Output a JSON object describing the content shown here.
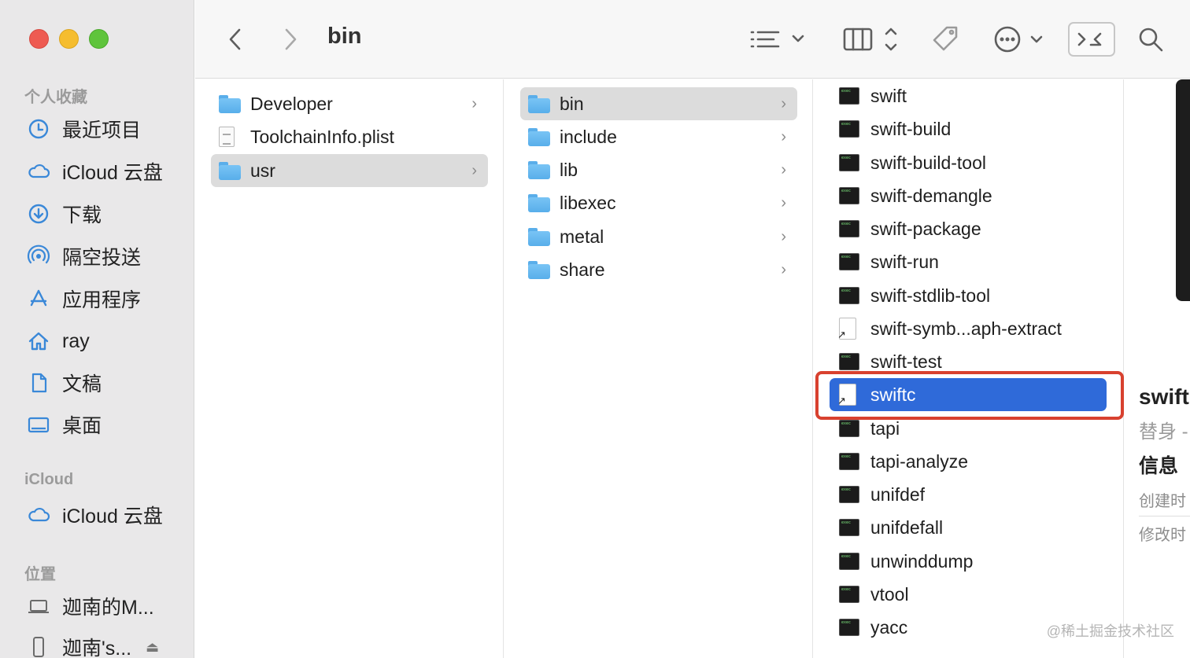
{
  "window": {
    "title": "bin"
  },
  "toolbar": {
    "back_icon": "chevron-left-icon",
    "forward_icon": "chevron-right-icon",
    "view_icon": "list-view-icon",
    "group_icon": "columns-icon",
    "tag_icon": "tag-icon",
    "more_icon": "ellipsis-circle-icon",
    "terminal_icon": "terminal-icon",
    "search_icon": "search-icon"
  },
  "sidebar": {
    "favorites_header": "个人收藏",
    "favorites": [
      {
        "label": "最近项目",
        "icon": "clock-icon"
      },
      {
        "label": "iCloud 云盘",
        "icon": "cloud-icon"
      },
      {
        "label": "下载",
        "icon": "download-icon"
      },
      {
        "label": "隔空投送",
        "icon": "airdrop-icon"
      },
      {
        "label": "应用程序",
        "icon": "apps-icon"
      },
      {
        "label": "ray",
        "icon": "home-icon"
      },
      {
        "label": "文稿",
        "icon": "document-icon"
      },
      {
        "label": "桌面",
        "icon": "desktop-icon"
      }
    ],
    "icloud_header": "iCloud",
    "icloud": [
      {
        "label": "iCloud 云盘",
        "icon": "cloud-icon"
      }
    ],
    "locations_header": "位置",
    "locations": [
      {
        "label": "迦南的M...",
        "icon": "laptop-icon"
      },
      {
        "label": "迦南's...",
        "icon": "phone-icon"
      }
    ]
  },
  "columns": [
    {
      "items": [
        {
          "name": "Developer",
          "type": "folder",
          "chevron": true
        },
        {
          "name": "ToolchainInfo.plist",
          "type": "plist",
          "chevron": false
        },
        {
          "name": "usr",
          "type": "folder",
          "chevron": true,
          "selected": "grey"
        }
      ]
    },
    {
      "items": [
        {
          "name": "bin",
          "type": "folder",
          "chevron": true,
          "selected": "grey"
        },
        {
          "name": "include",
          "type": "folder",
          "chevron": true
        },
        {
          "name": "lib",
          "type": "folder",
          "chevron": true
        },
        {
          "name": "libexec",
          "type": "folder",
          "chevron": true
        },
        {
          "name": "metal",
          "type": "folder",
          "chevron": true
        },
        {
          "name": "share",
          "type": "folder",
          "chevron": true
        }
      ]
    },
    {
      "items": [
        {
          "name": "swift",
          "type": "exec"
        },
        {
          "name": "swift-build",
          "type": "exec"
        },
        {
          "name": "swift-build-tool",
          "type": "exec"
        },
        {
          "name": "swift-demangle",
          "type": "exec"
        },
        {
          "name": "swift-package",
          "type": "exec"
        },
        {
          "name": "swift-run",
          "type": "exec"
        },
        {
          "name": "swift-stdlib-tool",
          "type": "exec"
        },
        {
          "name": "swift-symb...aph-extract",
          "type": "alias"
        },
        {
          "name": "swift-test",
          "type": "exec"
        },
        {
          "name": "swiftc",
          "type": "alias",
          "selected": "blue"
        },
        {
          "name": "tapi",
          "type": "exec"
        },
        {
          "name": "tapi-analyze",
          "type": "exec"
        },
        {
          "name": "unifdef",
          "type": "exec"
        },
        {
          "name": "unifdefall",
          "type": "exec"
        },
        {
          "name": "unwinddump",
          "type": "exec"
        },
        {
          "name": "vtool",
          "type": "exec"
        },
        {
          "name": "yacc",
          "type": "exec"
        }
      ]
    }
  ],
  "preview": {
    "name": "swift",
    "kind": "替身 -",
    "info_header": "信息",
    "created_label": "创建时",
    "modified_label": "修改时"
  },
  "watermark": "@稀土掘金技术社区",
  "colors": {
    "selection_blue": "#2f6ad9",
    "highlight_red": "#d8412f",
    "folder_blue": "#5aaeea"
  }
}
